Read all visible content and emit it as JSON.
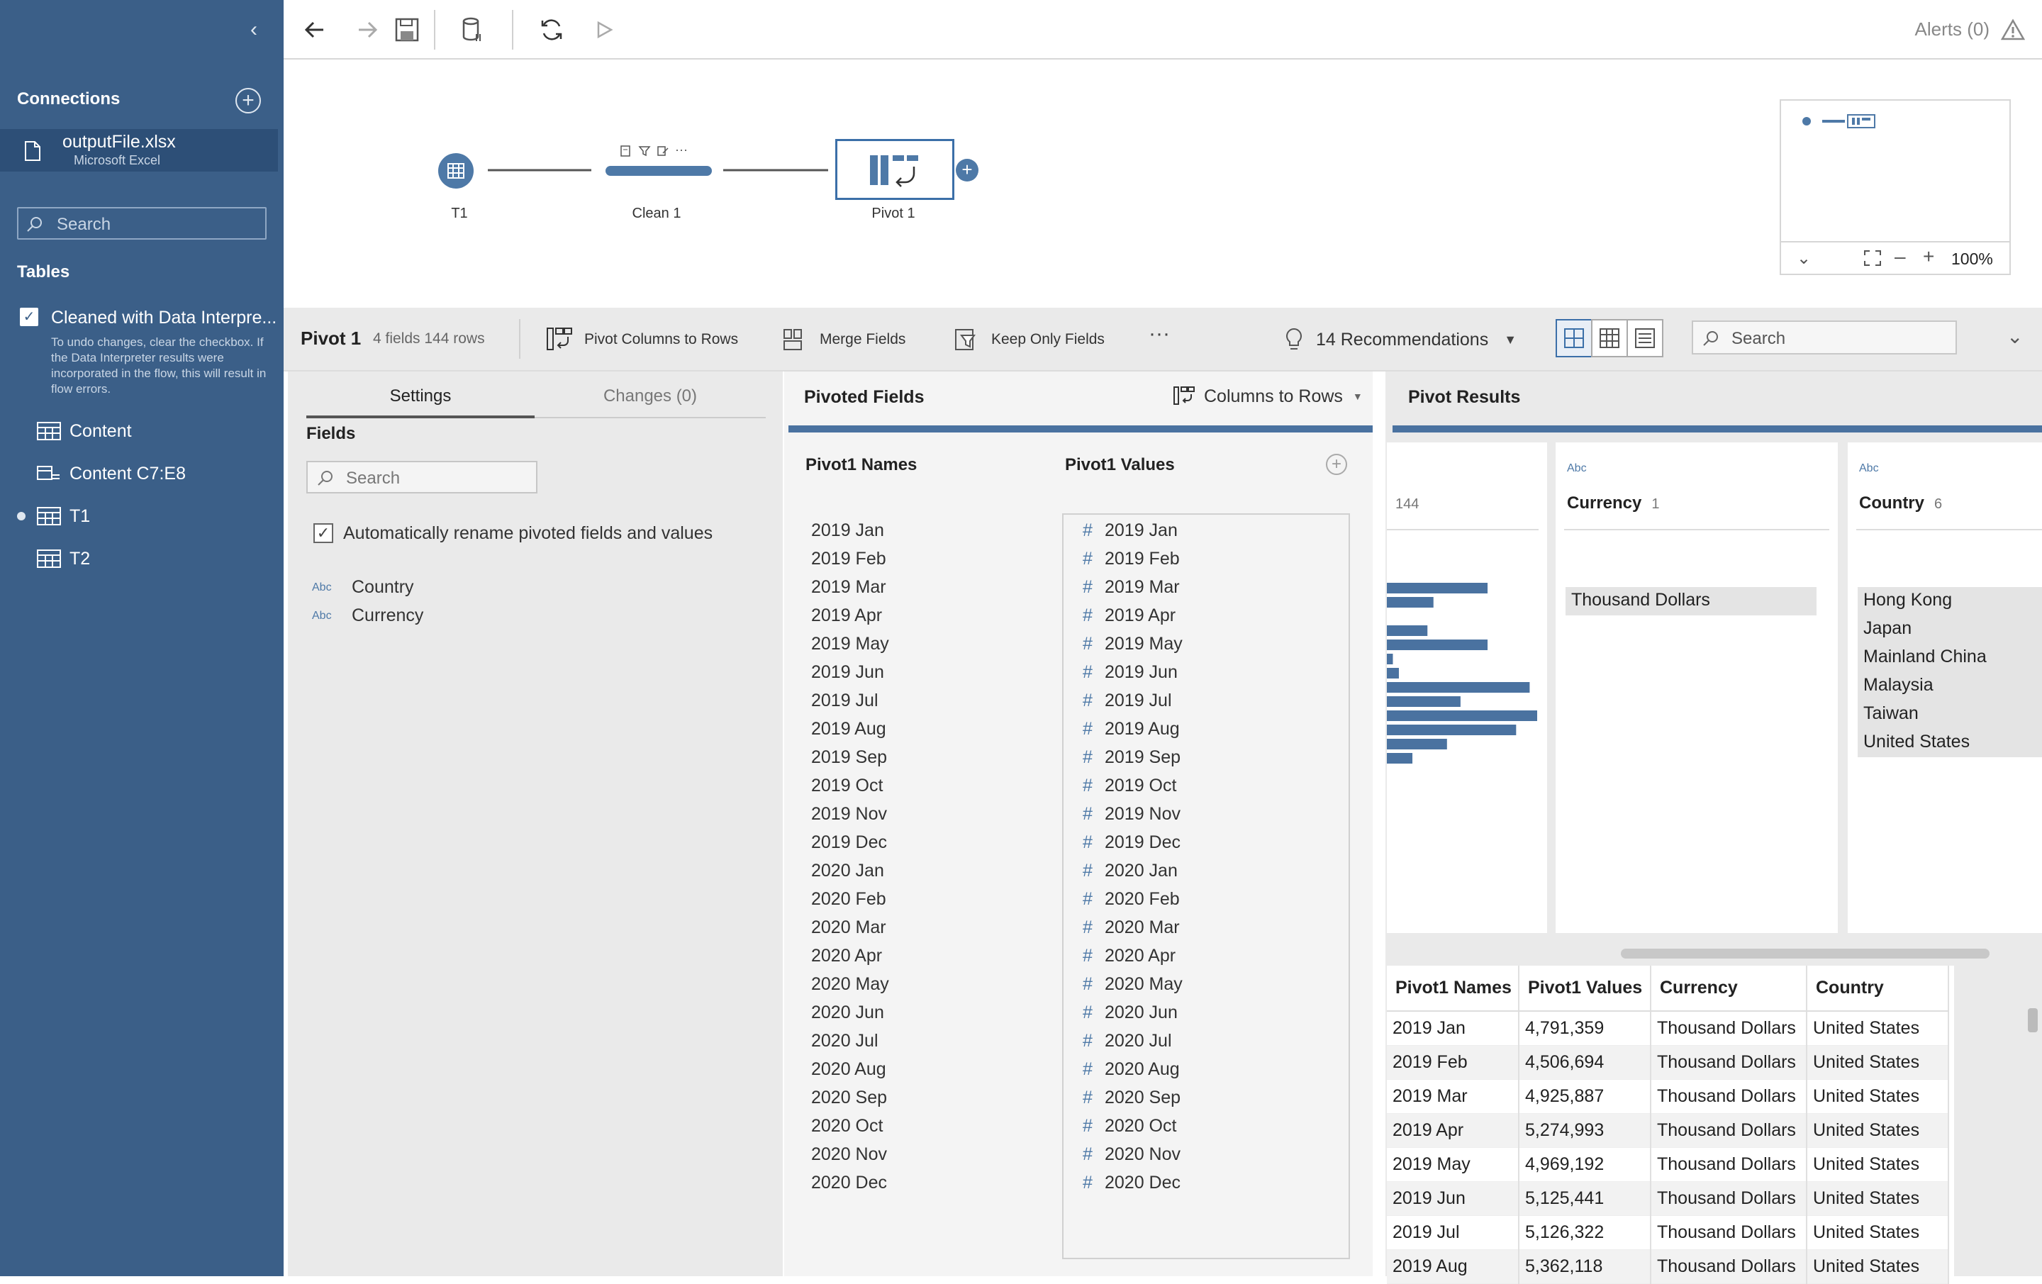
{
  "sidebar": {
    "connections_label": "Connections",
    "connection": {
      "name": "outputFile.xlsx",
      "type": "Microsoft Excel"
    },
    "search_placeholder": "Search",
    "tables_label": "Tables",
    "interpreter_label": "Cleaned with Data Interpre...",
    "interpreter_note": "To undo changes, clear the checkbox. If the Data Interpreter results were incorporated in the flow, this will result in flow errors.",
    "tables": [
      {
        "label": "Content"
      },
      {
        "label": "Content C7:E8"
      },
      {
        "label": "T1"
      },
      {
        "label": "T2"
      }
    ]
  },
  "toolbar": {
    "alerts": "Alerts (0)"
  },
  "flow": {
    "nodes": [
      {
        "label": "T1"
      },
      {
        "label": "Clean 1"
      },
      {
        "label": "Pivot 1"
      }
    ],
    "zoom": "100%"
  },
  "step": {
    "title": "Pivot 1",
    "meta": "4 fields  144 rows",
    "pivot_btn": "Pivot Columns to Rows",
    "merge_btn": "Merge Fields",
    "keep_btn": "Keep Only Fields",
    "more": "···",
    "recommendations": "14 Recommendations",
    "search_placeholder": "Search"
  },
  "settings": {
    "tab_settings": "Settings",
    "tab_changes": "Changes (0)",
    "fields_label": "Fields",
    "search_placeholder": "Search",
    "auto_rename": "Automatically rename pivoted fields and values",
    "fields": [
      {
        "type": "Abc",
        "name": "Country"
      },
      {
        "type": "Abc",
        "name": "Currency"
      }
    ]
  },
  "pivoted": {
    "title": "Pivoted Fields",
    "mode": "Columns to Rows",
    "names_header": "Pivot1 Names",
    "values_header": "Pivot1 Values",
    "items": [
      "2019 Jan",
      "2019 Feb",
      "2019 Mar",
      "2019 Apr",
      "2019 May",
      "2019 Jun",
      "2019 Jul",
      "2019 Aug",
      "2019 Sep",
      "2019 Oct",
      "2019 Nov",
      "2019 Dec",
      "2020 Jan",
      "2020 Feb",
      "2020 Mar",
      "2020 Apr",
      "2020 May",
      "2020 Jun",
      "2020 Jul",
      "2020 Aug",
      "2020 Sep",
      "2020 Oct",
      "2020 Nov",
      "2020 Dec"
    ]
  },
  "results": {
    "title": "Pivot Results",
    "profile_partial_count": "144",
    "currency": {
      "type": "Abc",
      "name": "Currency",
      "count": "1",
      "values": [
        "Thousand Dollars"
      ]
    },
    "country": {
      "type": "Abc",
      "name": "Country",
      "count": "6",
      "values": [
        "Hong Kong",
        "Japan",
        "Mainland China",
        "Malaysia",
        "Taiwan",
        "United States"
      ]
    },
    "histogram_fractions": [
      0.67,
      0.31,
      0,
      0.27,
      0.67,
      0.04,
      0.08,
      0.95,
      0.49,
      1.0,
      0.86,
      0.4,
      0.17
    ],
    "grid": {
      "headers": [
        "Pivot1 Names",
        "Pivot1 Values",
        "Currency",
        "Country"
      ],
      "rows": [
        [
          "2019 Jan",
          "4,791,359",
          "Thousand Dollars",
          "United States"
        ],
        [
          "2019 Feb",
          "4,506,694",
          "Thousand Dollars",
          "United States"
        ],
        [
          "2019 Mar",
          "4,925,887",
          "Thousand Dollars",
          "United States"
        ],
        [
          "2019 Apr",
          "5,274,993",
          "Thousand Dollars",
          "United States"
        ],
        [
          "2019 May",
          "4,969,192",
          "Thousand Dollars",
          "United States"
        ],
        [
          "2019 Jun",
          "5,125,441",
          "Thousand Dollars",
          "United States"
        ],
        [
          "2019 Jul",
          "5,126,322",
          "Thousand Dollars",
          "United States"
        ],
        [
          "2019 Aug",
          "5,362,118",
          "Thousand Dollars",
          "United States"
        ]
      ]
    }
  },
  "colors": {
    "sidebar": "#3b5f88",
    "accent": "#4a72a0",
    "selected": "#3b6fa8"
  }
}
